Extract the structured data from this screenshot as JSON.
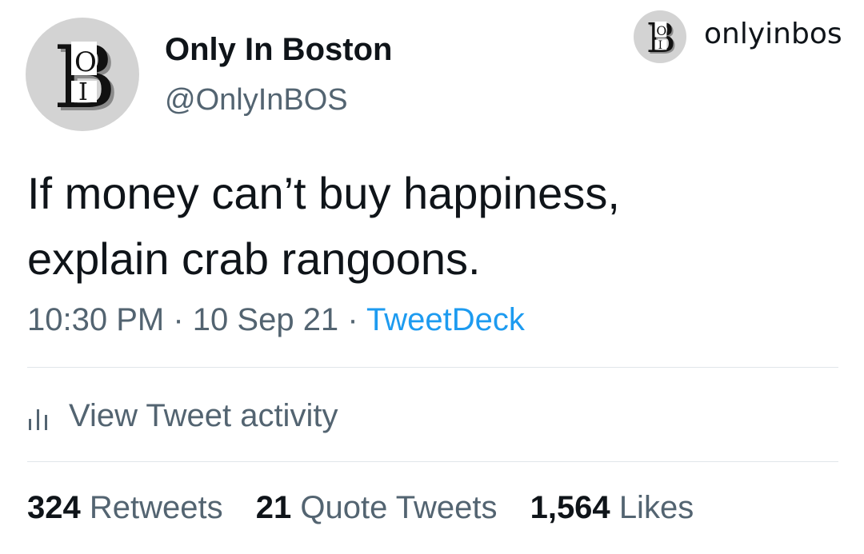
{
  "author": {
    "display_name": "Only In Boston",
    "handle": "@OnlyInBOS",
    "avatar_icon": "boston-bio-logo-icon",
    "avatar_logo_letters": "B O I"
  },
  "watermark": {
    "username": "onlyinbos",
    "logo_icon": "boston-bio-logo-icon",
    "logo_letters": "B O I"
  },
  "tweet": {
    "text": "If money can’t buy happiness,\nexplain crab rangoons.",
    "time": "10:30 PM",
    "separator": "·",
    "date": "10 Sep 21",
    "source": "TweetDeck"
  },
  "activity": {
    "label": "View Tweet activity",
    "icon": "bar-chart-icon"
  },
  "stats": {
    "retweets_count": "324",
    "retweets_label": "Retweets",
    "quotes_count": "21",
    "quotes_label": "Quote Tweets",
    "likes_count": "1,564",
    "likes_label": "Likes"
  },
  "colors": {
    "text_primary": "#0f1419",
    "text_secondary": "#536471",
    "link": "#1d9bf0",
    "divider": "#e1e6ea",
    "avatar_bg": "#d3d3d3"
  }
}
